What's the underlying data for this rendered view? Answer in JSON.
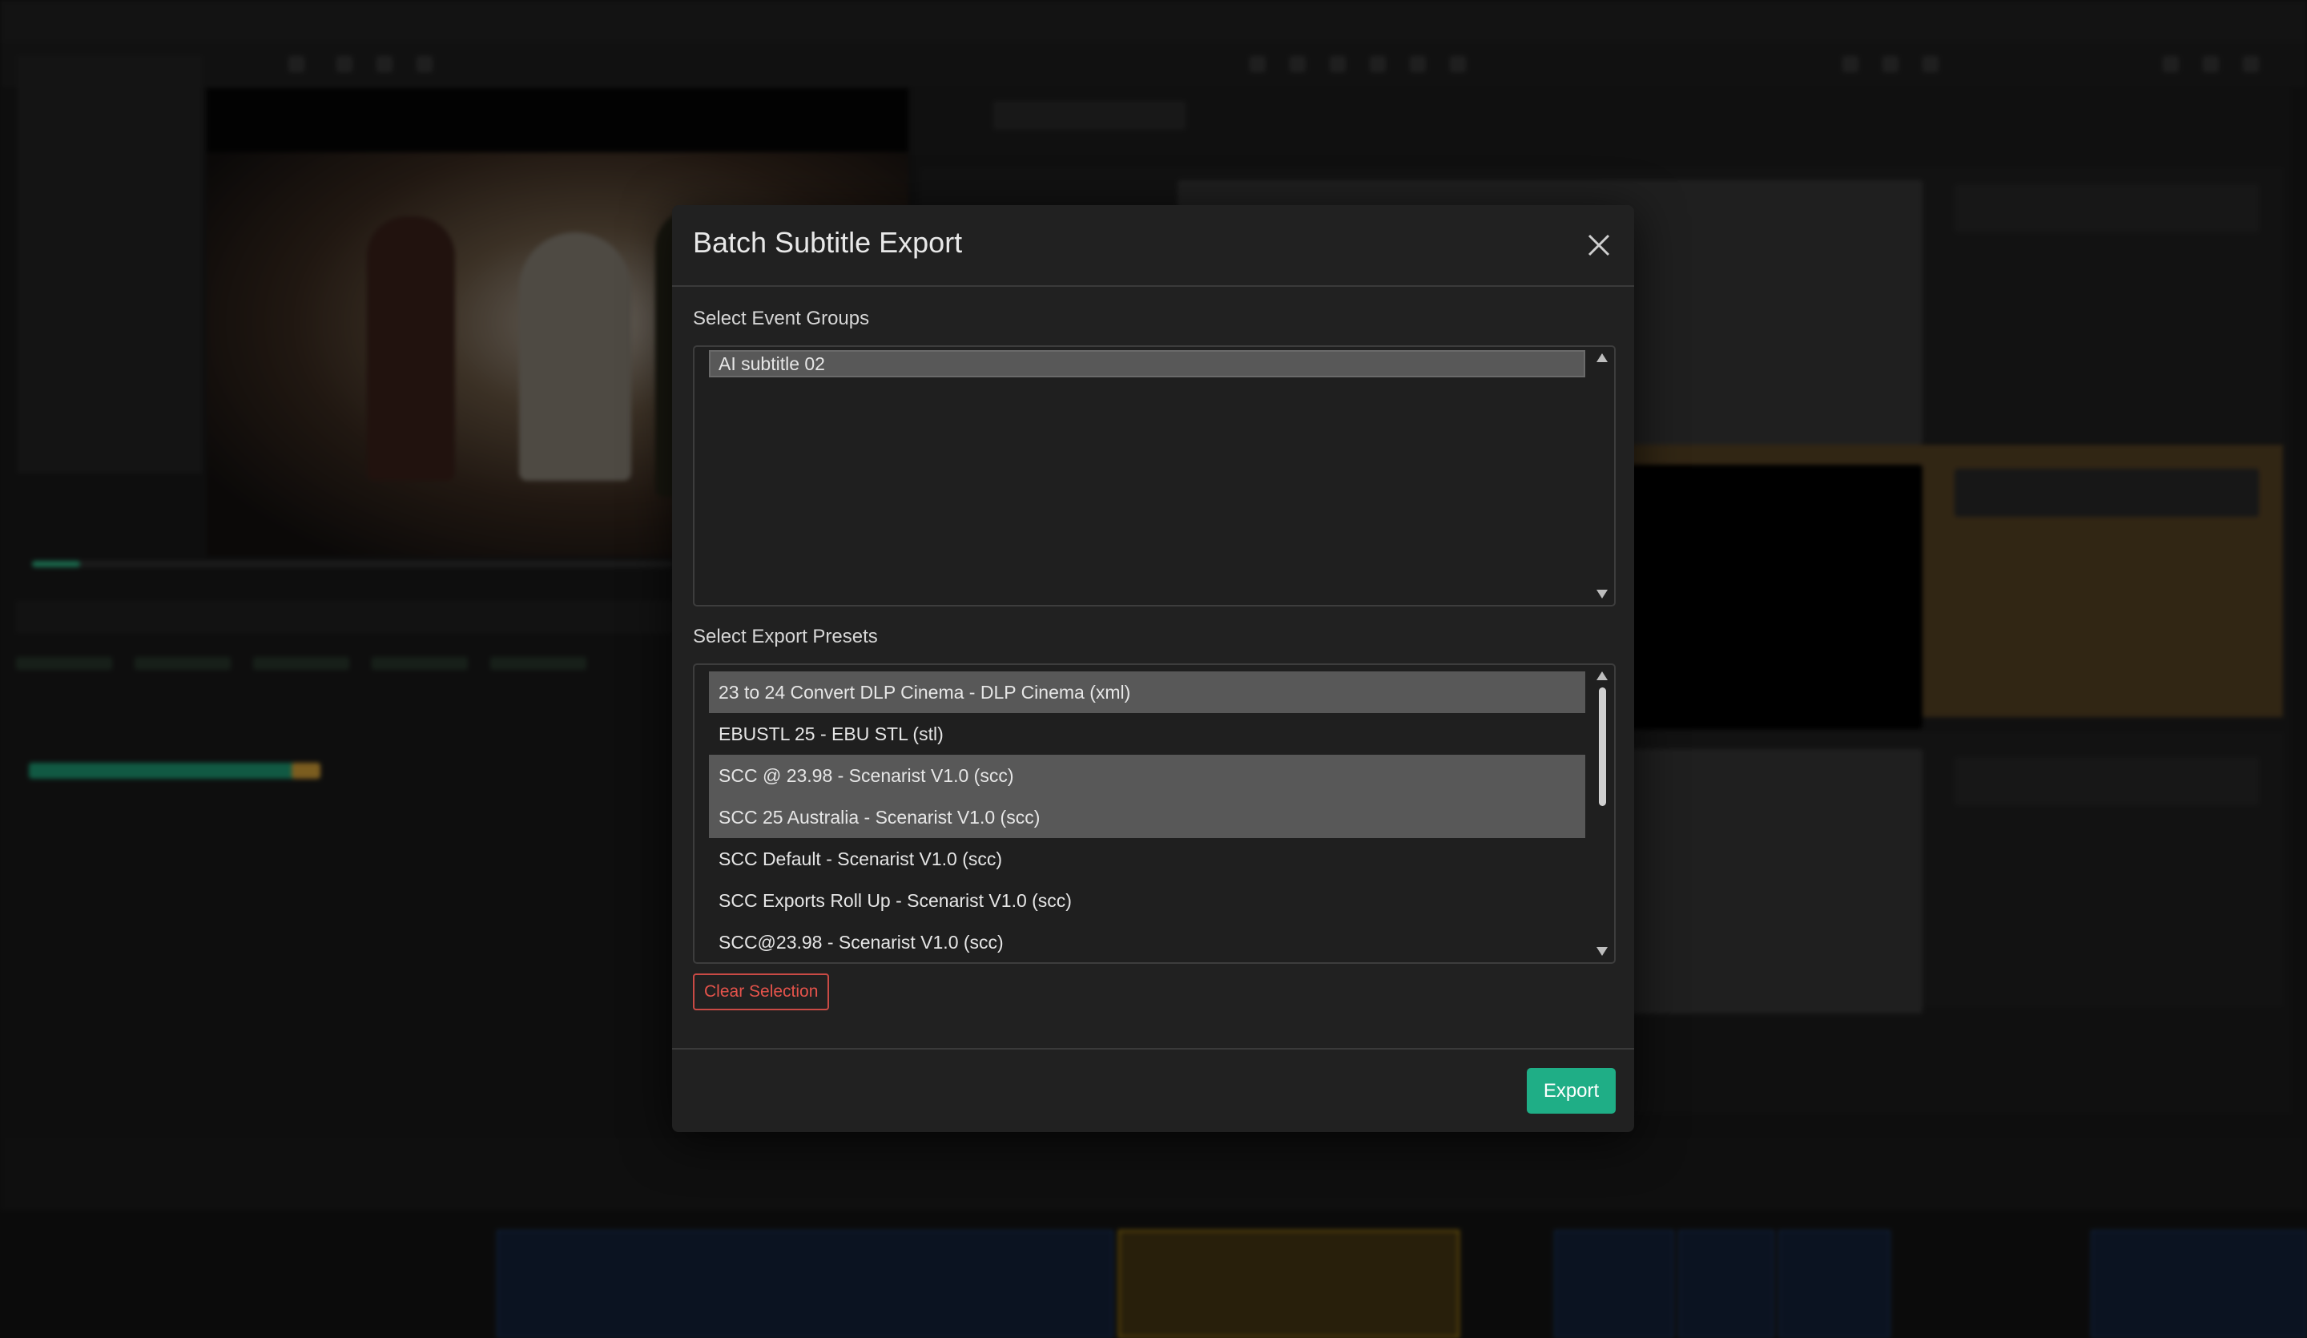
{
  "dialog": {
    "title": "Batch Subtitle Export",
    "event_groups_label": "Select Event Groups",
    "event_groups": [
      {
        "label": "AI subtitle 02",
        "selected": true
      }
    ],
    "export_presets_label": "Select Export Presets",
    "export_presets": [
      {
        "label": "23 to 24 Convert DLP Cinema - DLP Cinema (xml)",
        "selected": true
      },
      {
        "label": "EBUSTL 25 - EBU STL (stl)",
        "selected": false
      },
      {
        "label": "SCC @ 23.98 - Scenarist V1.0 (scc)",
        "selected": true
      },
      {
        "label": "SCC 25 Australia - Scenarist V1.0 (scc)",
        "selected": true
      },
      {
        "label": "SCC Default - Scenarist V1.0 (scc)",
        "selected": false
      },
      {
        "label": "SCC Exports Roll Up - Scenarist V1.0 (scc)",
        "selected": false
      },
      {
        "label": "SCC@23.98 - Scenarist V1.0 (scc)",
        "selected": false
      }
    ],
    "clear_selection_label": "Clear Selection",
    "export_label": "Export"
  },
  "icons": {
    "close": "close-icon",
    "scroll_up": "chevron-up-icon",
    "scroll_down": "chevron-down-icon"
  },
  "colors": {
    "accent": "#1fae86",
    "danger": "#e5534b",
    "selection": "#585858",
    "dialog_bg": "#212121"
  }
}
